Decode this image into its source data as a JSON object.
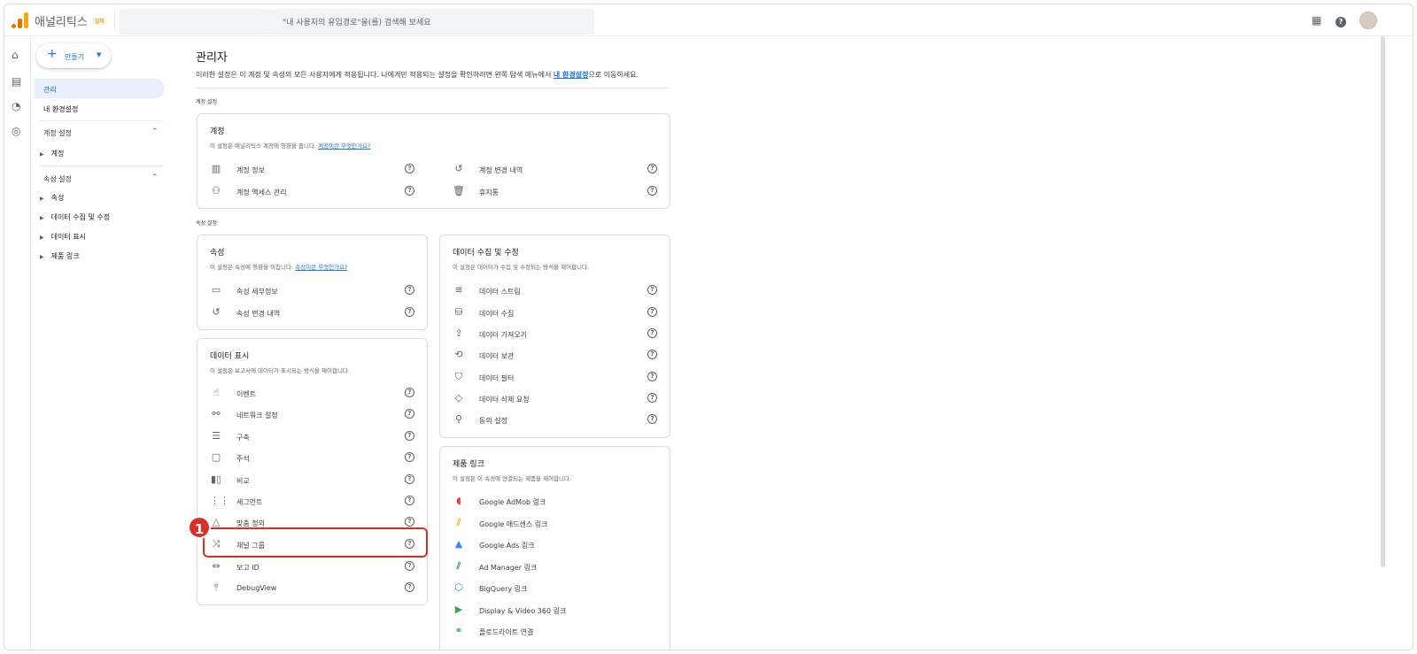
{
  "topbar": {
    "app_title": "애널리틱스",
    "badge": "알파",
    "search_placeholder": "\"내 사용자의 유입경로\"을(를) 검색해 보세요"
  },
  "sidebar": {
    "create_label": "만들기",
    "admin_label": "관리",
    "my_settings_label": "내 환경설정",
    "account_settings": {
      "label": "계정 설정",
      "items": [
        "계정"
      ]
    },
    "property_settings": {
      "label": "속성 설정",
      "items": [
        "속성",
        "데이터 수집 및 수정",
        "데이터 표시",
        "제품 링크"
      ]
    }
  },
  "main": {
    "title": "관리자",
    "desc_prefix": "이러한 설정은 이 계정 및 속성의 모든 사용자에게 적용됩니다. 나에게만 적용되는 설정을 확인하려면 왼쪽 탐색 메뉴에서 ",
    "desc_link": "내 환경설정",
    "desc_suffix": "으로 이동하세요.",
    "account_section_label": "계정 설정",
    "property_section_label": "속성 설정"
  },
  "cards": {
    "account": {
      "title": "계정",
      "desc": "이 설정은 애널리틱스 계정에 영향을 줍니다. ",
      "desc_link": "계정이란 무엇인가요?",
      "left": [
        "계정 정보",
        "계정 액세스 관리"
      ],
      "right": [
        "계정 변경 내역",
        "휴지통"
      ]
    },
    "property": {
      "title": "속성",
      "desc": "이 설정은 속성에 영향을 미칩니다. ",
      "desc_link": "속성이란 무엇인가요?",
      "items": [
        "속성 세부정보",
        "속성 변경 내역"
      ]
    },
    "data_display": {
      "title": "데이터 표시",
      "desc": "이 설정은 보고서에 데이터가 표시되는 방식을 제어합니다.",
      "items": [
        "이벤트",
        "네트워크 설정",
        "구축",
        "주석",
        "비교",
        "세그먼트",
        "맞춤 정의",
        "채널 그룹",
        "보고 ID",
        "DebugView"
      ]
    },
    "data_collection": {
      "title": "데이터 수집 및 수정",
      "desc": "이 설정은 데이터가 수집 및 수정되는 방식을 제어합니다.",
      "items": [
        "데이터 스트림",
        "데이터 수집",
        "데이터 가져오기",
        "데이터 보관",
        "데이터 필터",
        "데이터 삭제 요청",
        "동의 설정"
      ]
    },
    "product_links": {
      "title": "제품 링크",
      "desc": "이 설정은 이 속성에 연결되는 제품을 제어합니다.",
      "items": [
        "Google AdMob 링크",
        "Google 애드센스 링크",
        "Google Ads 링크",
        "Ad Manager 링크",
        "BigQuery 링크",
        "Display & Video 360 링크",
        "플로드라이트 연결"
      ]
    }
  },
  "annotation": {
    "step": "1"
  },
  "colors": {
    "accent": "#1a73e8",
    "highlight": "#d93025",
    "logo_orange": "#f9ab00",
    "logo_dark": "#e37400"
  }
}
